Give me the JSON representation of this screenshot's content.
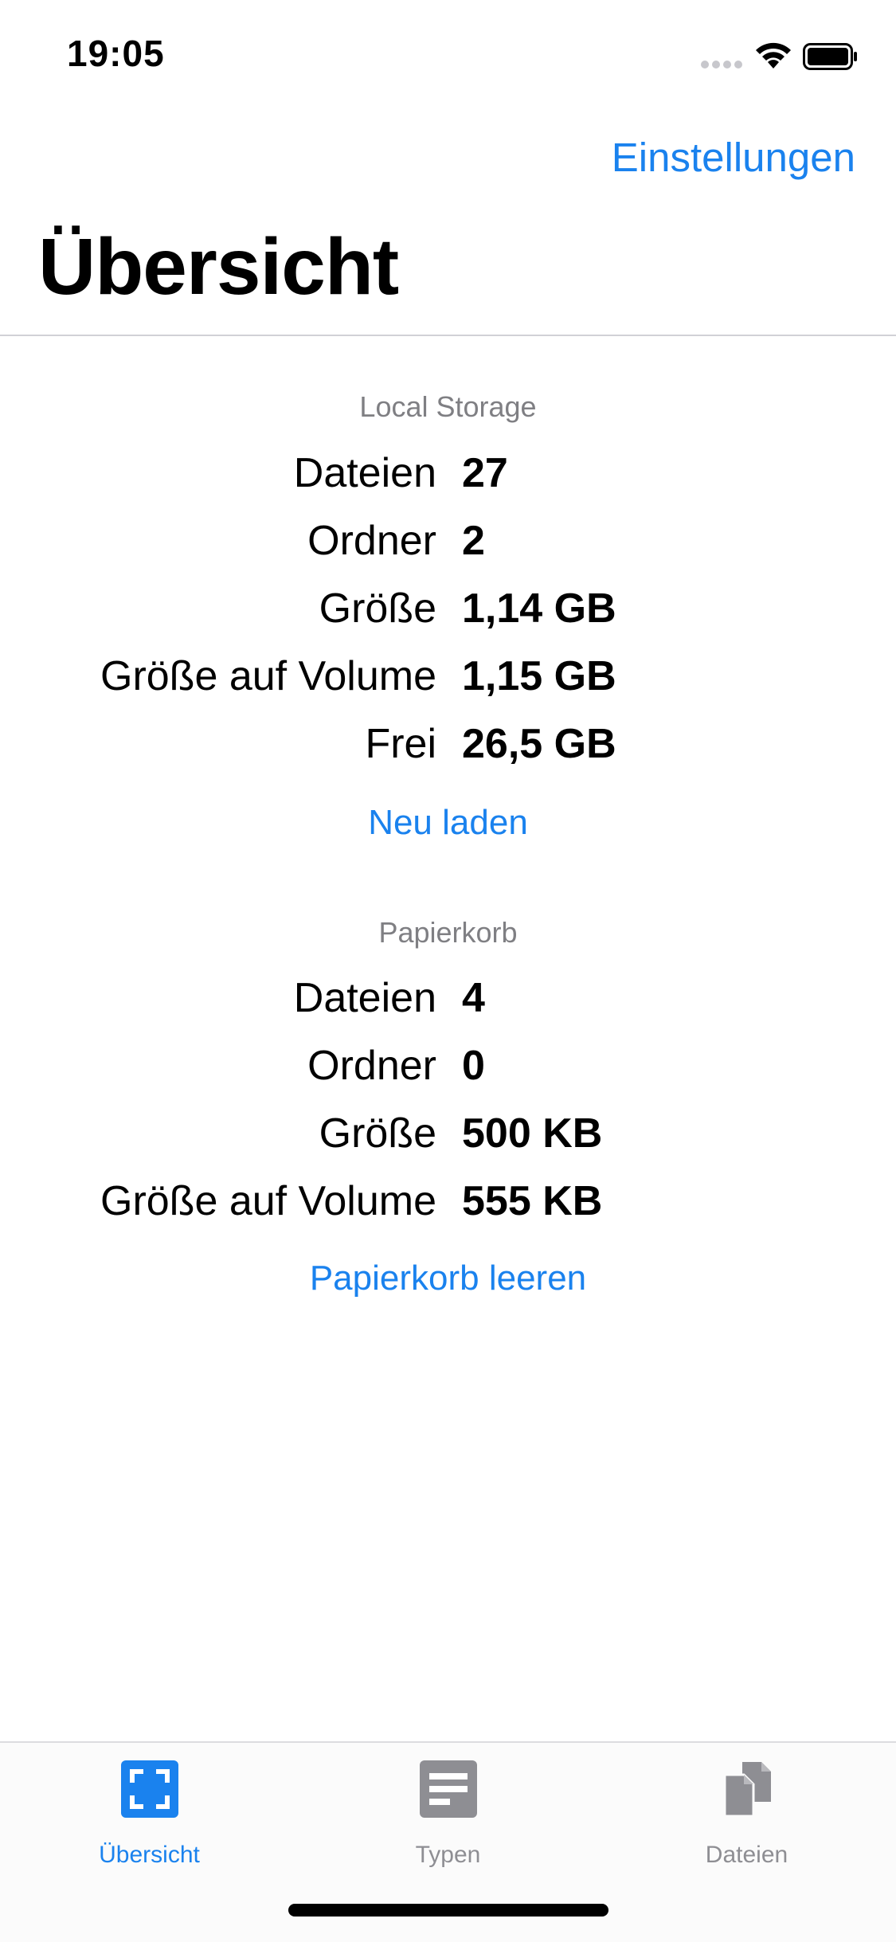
{
  "status_bar": {
    "time": "19:05"
  },
  "nav": {
    "settings_label": "Einstellungen",
    "title": "Übersicht"
  },
  "local_storage": {
    "header": "Local Storage",
    "rows": [
      {
        "label": "Dateien",
        "value": "27"
      },
      {
        "label": "Ordner",
        "value": "2"
      },
      {
        "label": "Größe",
        "value": "1,14 GB"
      },
      {
        "label": "Größe auf Volume",
        "value": "1,15 GB"
      },
      {
        "label": "Frei",
        "value": "26,5 GB"
      }
    ],
    "action": "Neu laden"
  },
  "trash": {
    "header": "Papierkorb",
    "rows": [
      {
        "label": "Dateien",
        "value": "4"
      },
      {
        "label": "Ordner",
        "value": "0"
      },
      {
        "label": "Größe",
        "value": "500 KB"
      },
      {
        "label": "Größe auf Volume",
        "value": "555 KB"
      }
    ],
    "action": "Papierkorb leeren"
  },
  "tabbar": {
    "tabs": [
      {
        "label": "Übersicht",
        "icon": "overview-icon",
        "active": true
      },
      {
        "label": "Typen",
        "icon": "types-icon",
        "active": false
      },
      {
        "label": "Dateien",
        "icon": "files-icon",
        "active": false
      }
    ],
    "active_color": "#1a82ee",
    "inactive_color": "#8e8e93"
  },
  "colors": {
    "accent": "#1a82ee",
    "secondary_text": "#7f7f83"
  }
}
